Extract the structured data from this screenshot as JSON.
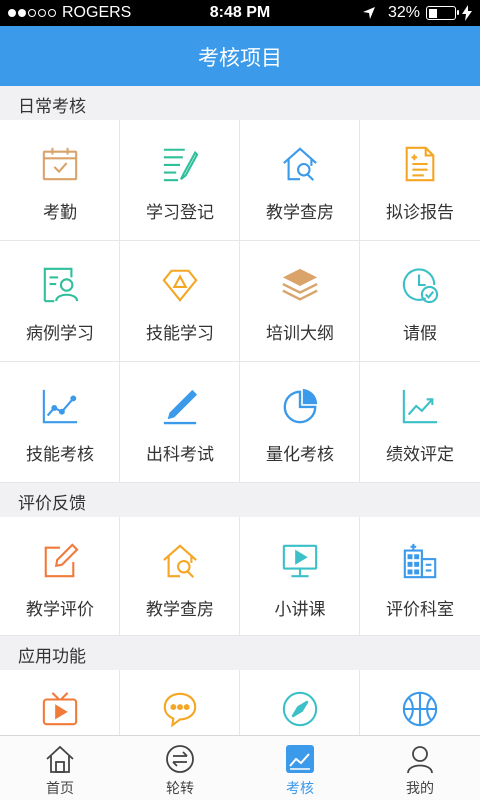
{
  "status": {
    "carrier": "ROGERS",
    "time": "8:48 PM",
    "battery": "32%",
    "battery_level": 0.32
  },
  "header": {
    "title": "考核项目"
  },
  "sections": [
    {
      "title": "日常考核"
    },
    {
      "title": "评价反馈"
    },
    {
      "title": "应用功能"
    }
  ],
  "daily": [
    {
      "label": "考勤",
      "icon": "calendar-check-icon",
      "color": "#d9a36a"
    },
    {
      "label": "学习登记",
      "icon": "list-pen-icon",
      "color": "#2fbf9a"
    },
    {
      "label": "教学查房",
      "icon": "house-search-icon",
      "color": "#3b9ae9"
    },
    {
      "label": "拟诊报告",
      "icon": "report-icon",
      "color": "#f5a623"
    },
    {
      "label": "病例学习",
      "icon": "case-study-icon",
      "color": "#2fbf9a"
    },
    {
      "label": "技能学习",
      "icon": "diamond-icon",
      "color": "#f5a623"
    },
    {
      "label": "培训大纲",
      "icon": "layers-icon",
      "color": "#d9a36a"
    },
    {
      "label": "请假",
      "icon": "clock-check-icon",
      "color": "#3bc0c8"
    },
    {
      "label": "技能考核",
      "icon": "line-chart-icon",
      "color": "#3b9ae9"
    },
    {
      "label": "出科考试",
      "icon": "pen-icon",
      "color": "#3b9ae9"
    },
    {
      "label": "量化考核",
      "icon": "pie-chart-icon",
      "color": "#3b9ae9"
    },
    {
      "label": "绩效评定",
      "icon": "trend-chart-icon",
      "color": "#3bc0c8"
    }
  ],
  "feedback": [
    {
      "label": "教学评价",
      "icon": "edit-icon",
      "color": "#f07a3a"
    },
    {
      "label": "教学查房",
      "icon": "house-search-icon",
      "color": "#f5a623"
    },
    {
      "label": "小讲课",
      "icon": "video-screen-icon",
      "color": "#3bc0c8"
    },
    {
      "label": "评价科室",
      "icon": "hospital-icon",
      "color": "#3b9ae9"
    }
  ],
  "apps": [
    {
      "icon": "tv-icon",
      "color": "#f07a3a"
    },
    {
      "icon": "chat-icon",
      "color": "#f5a623"
    },
    {
      "icon": "compass-icon",
      "color": "#3bc0c8"
    },
    {
      "icon": "basketball-icon",
      "color": "#3b9ae9"
    }
  ],
  "tabs": [
    {
      "label": "首页",
      "icon": "home-icon"
    },
    {
      "label": "轮转",
      "icon": "rotate-icon"
    },
    {
      "label": "考核",
      "icon": "assessment-icon",
      "active": true
    },
    {
      "label": "我的",
      "icon": "user-icon"
    }
  ],
  "colors": {
    "primary": "#3b9ae9",
    "tab_inactive": "#444444"
  }
}
